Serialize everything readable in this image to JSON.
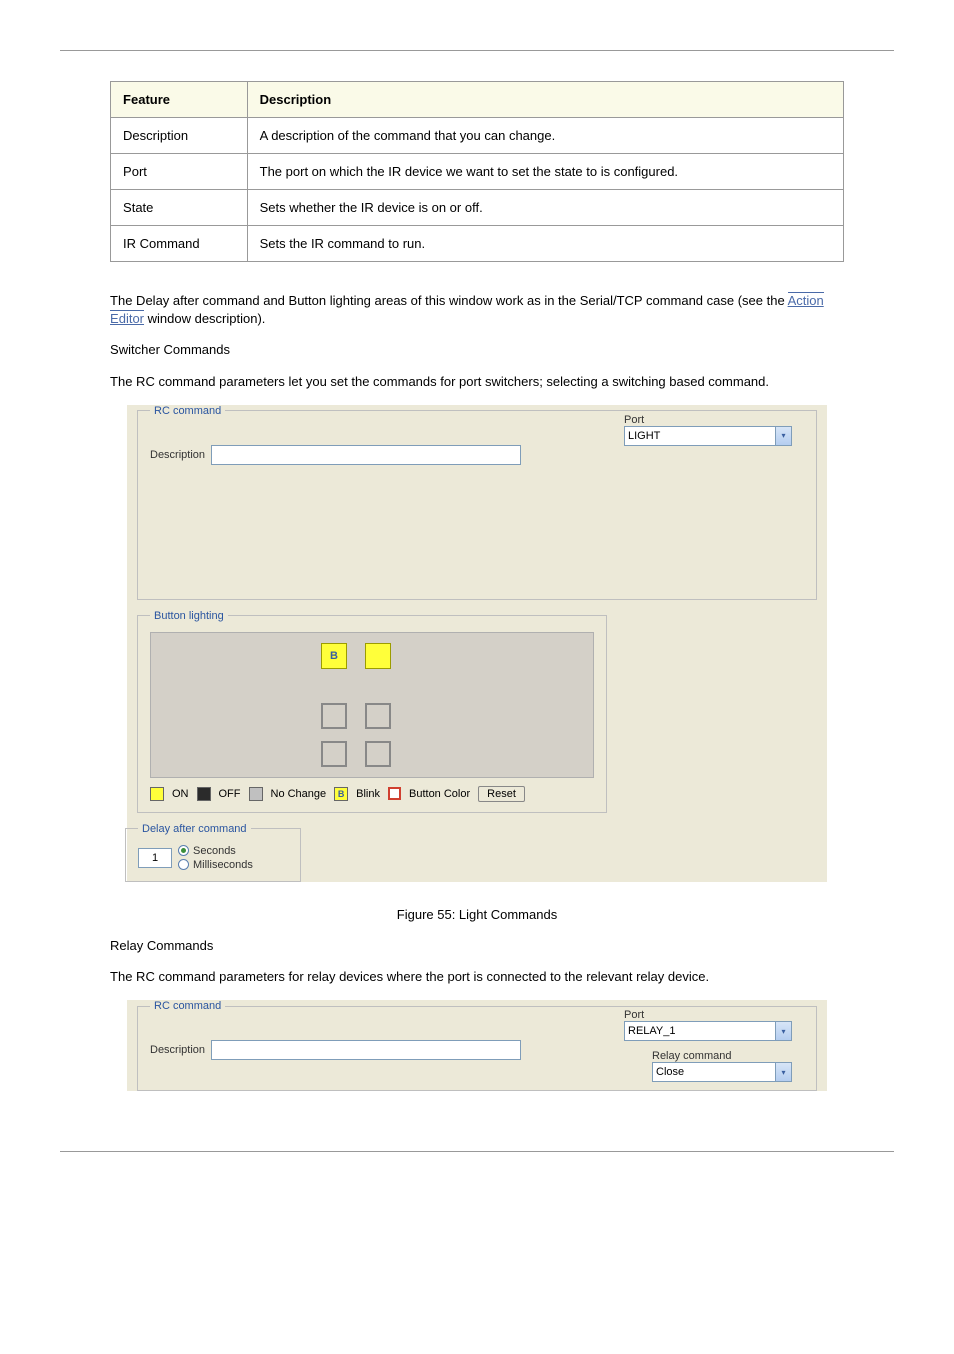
{
  "table": {
    "header_feat": "Feature",
    "header_desc": "Description",
    "rows": [
      {
        "feat": "Description",
        "desc": "A description of the command that you can change."
      },
      {
        "feat": "Port",
        "desc": "The port on which the IR device we want to set the state to is configured."
      },
      {
        "feat": "State",
        "desc": "Sets whether the IR device is on or off."
      },
      {
        "feat": "IR Command",
        "desc": "Sets the IR command to run."
      }
    ]
  },
  "para1_pre": "The Delay after command and Button lighting areas of this window work as in the Serial/TCP command case (see the ",
  "para1_link": "Action Editor",
  "para1_post": " window description).",
  "h_sw1": "Switcher Commands",
  "para2": "The RC command parameters let you set the commands for port switchers; selecting a switching based command.",
  "shot1": {
    "fs": "RC command",
    "desc_lbl": "Description",
    "port_lbl": "Port",
    "port_val": "LIGHT",
    "lighting_fs": "Button lighting",
    "b_glyph": "B",
    "leg_on": "ON",
    "leg_off": "OFF",
    "leg_nc": "No Change",
    "leg_blink": "Blink",
    "leg_bc": "Button Color",
    "reset": "Reset",
    "delay_fs": "Delay after command",
    "delay_val": "1",
    "r_sec": "Seconds",
    "r_ms": "Milliseconds"
  },
  "fig1": "Figure 55: Light Commands",
  "h_relay": "Relay Commands",
  "para3": "The RC command parameters for relay devices where the port is connected to the relevant relay device.",
  "shot2": {
    "fs": "RC command",
    "desc_lbl": "Description",
    "port_lbl": "Port",
    "port_val": "RELAY_1",
    "relay_cmd_lbl": "Relay command",
    "relay_cmd_val": "Close"
  }
}
